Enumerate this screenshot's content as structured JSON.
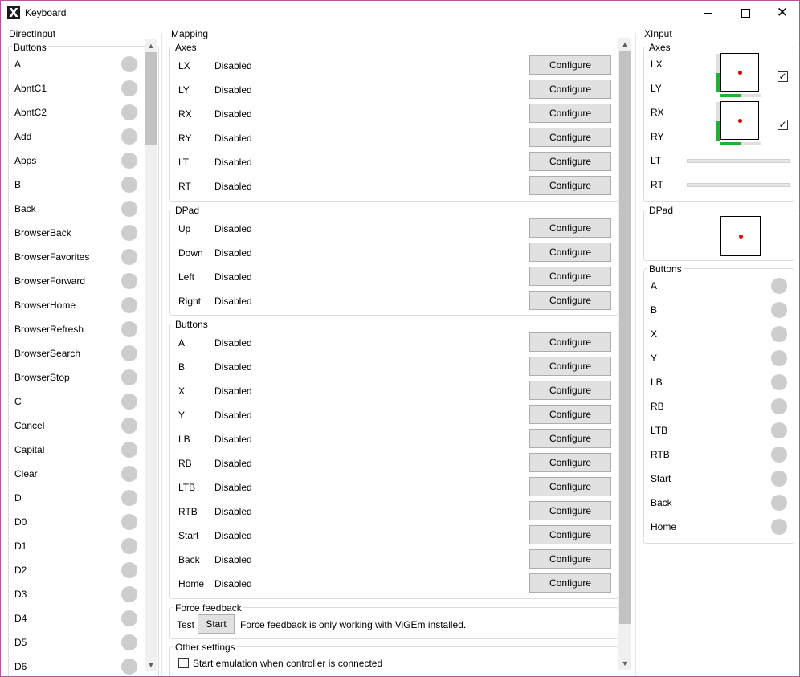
{
  "window": {
    "title": "Keyboard"
  },
  "directinput": {
    "title": "DirectInput",
    "buttons_title": "Buttons",
    "buttons": [
      "A",
      "AbntC1",
      "AbntC2",
      "Add",
      "Apps",
      "B",
      "Back",
      "BrowserBack",
      "BrowserFavorites",
      "BrowserForward",
      "BrowserHome",
      "BrowserRefresh",
      "BrowserSearch",
      "BrowserStop",
      "C",
      "Cancel",
      "Capital",
      "Clear",
      "D",
      "D0",
      "D1",
      "D2",
      "D3",
      "D4",
      "D5",
      "D6"
    ]
  },
  "mapping": {
    "title": "Mapping",
    "configure_label": "Configure",
    "axes": {
      "title": "Axes",
      "rows": [
        {
          "label": "LX",
          "value": "Disabled"
        },
        {
          "label": "LY",
          "value": "Disabled"
        },
        {
          "label": "RX",
          "value": "Disabled"
        },
        {
          "label": "RY",
          "value": "Disabled"
        },
        {
          "label": "LT",
          "value": "Disabled"
        },
        {
          "label": "RT",
          "value": "Disabled"
        }
      ]
    },
    "dpad": {
      "title": "DPad",
      "rows": [
        {
          "label": "Up",
          "value": "Disabled"
        },
        {
          "label": "Down",
          "value": "Disabled"
        },
        {
          "label": "Left",
          "value": "Disabled"
        },
        {
          "label": "Right",
          "value": "Disabled"
        }
      ]
    },
    "buttons": {
      "title": "Buttons",
      "rows": [
        {
          "label": "A",
          "value": "Disabled"
        },
        {
          "label": "B",
          "value": "Disabled"
        },
        {
          "label": "X",
          "value": "Disabled"
        },
        {
          "label": "Y",
          "value": "Disabled"
        },
        {
          "label": "LB",
          "value": "Disabled"
        },
        {
          "label": "RB",
          "value": "Disabled"
        },
        {
          "label": "LTB",
          "value": "Disabled"
        },
        {
          "label": "RTB",
          "value": "Disabled"
        },
        {
          "label": "Start",
          "value": "Disabled"
        },
        {
          "label": "Back",
          "value": "Disabled"
        },
        {
          "label": "Home",
          "value": "Disabled"
        }
      ]
    },
    "force_feedback": {
      "title": "Force feedback",
      "test_label": "Test",
      "start_label": "Start",
      "note": "Force feedback is only working with ViGEm installed."
    },
    "other_settings": {
      "title": "Other settings",
      "start_emulation_label": "Start emulation when controller is connected",
      "start_emulation_checked": false
    }
  },
  "xinput": {
    "title": "XInput",
    "axes": {
      "title": "Axes",
      "labels": [
        "LX",
        "LY",
        "RX",
        "RY",
        "LT",
        "RT"
      ],
      "left_stick_checked": true,
      "right_stick_checked": true,
      "left_stick_x_level": 0.5,
      "left_stick_y_level": 0.5,
      "right_stick_x_level": 0.5,
      "right_stick_y_level": 0.5,
      "lt_level": 0.0,
      "rt_level": 0.0
    },
    "dpad": {
      "title": "DPad"
    },
    "buttons": {
      "title": "Buttons",
      "labels": [
        "A",
        "B",
        "X",
        "Y",
        "LB",
        "RB",
        "LTB",
        "RTB",
        "Start",
        "Back",
        "Home"
      ]
    }
  },
  "colors": {
    "accent_fill": "#22b232",
    "indicator_dot": "#e00000",
    "button_face": "#e1e1e1",
    "window_border": "#b4549a"
  }
}
